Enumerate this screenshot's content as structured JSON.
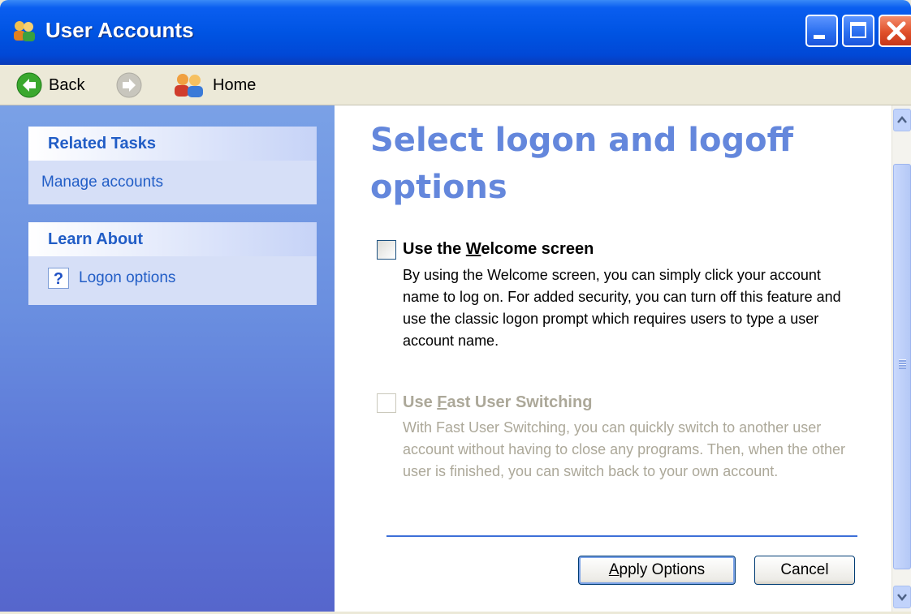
{
  "window": {
    "title": "User Accounts"
  },
  "toolbar": {
    "back_label": "Back",
    "home_label": "Home"
  },
  "sidebar": {
    "related_tasks": {
      "header": "Related Tasks",
      "items": [
        "Manage accounts"
      ]
    },
    "learn_about": {
      "header": "Learn About",
      "items": [
        "Logon options"
      ]
    }
  },
  "main": {
    "title": "Select logon and logoff options",
    "options": [
      {
        "title_prefix": "Use the ",
        "title_accel": "W",
        "title_suffix": "elcome screen",
        "checked": false,
        "enabled": true,
        "description": "By using the Welcome screen, you can simply click your account name to log on. For added security, you can turn off this feature and use the classic logon prompt which requires users to type a user account name."
      },
      {
        "title_prefix": "Use ",
        "title_accel": "F",
        "title_suffix": "ast User Switching",
        "checked": false,
        "enabled": false,
        "description": "With Fast User Switching, you can quickly switch to another user account without having to close any programs. Then, when the other user is finished, you can switch back to your own account."
      }
    ],
    "buttons": {
      "apply_accel": "A",
      "apply_rest": "pply Options",
      "cancel": "Cancel"
    }
  },
  "colors": {
    "title_bar": "#0054e3",
    "title_text": "#6487dc",
    "link": "#215dc6",
    "disabled_text": "#aca899"
  }
}
